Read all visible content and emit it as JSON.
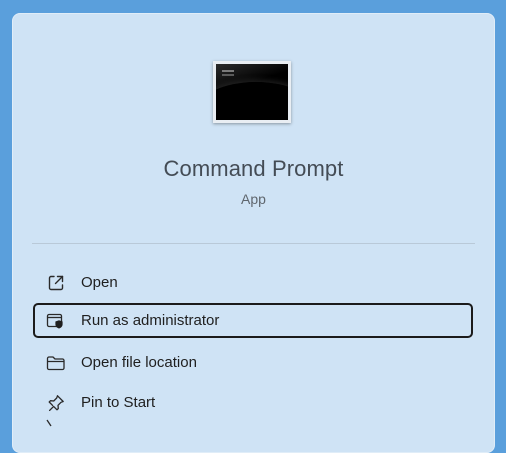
{
  "app": {
    "name": "Command Prompt",
    "type": "App",
    "icon": "command-prompt-icon"
  },
  "menu": {
    "items": [
      {
        "label": "Open",
        "icon": "open-external-icon"
      },
      {
        "label": "Run as administrator",
        "icon": "shield-admin-icon",
        "focused": true
      },
      {
        "label": "Open file location",
        "icon": "folder-icon"
      },
      {
        "label": "Pin to Start",
        "icon": "pin-icon"
      }
    ]
  },
  "colors": {
    "background": "#5a9fdc",
    "panel": "#cfe3f5",
    "focus_border": "#1b1b1b",
    "text_primary": "#1f1f1f",
    "text_secondary": "#5f666d"
  }
}
